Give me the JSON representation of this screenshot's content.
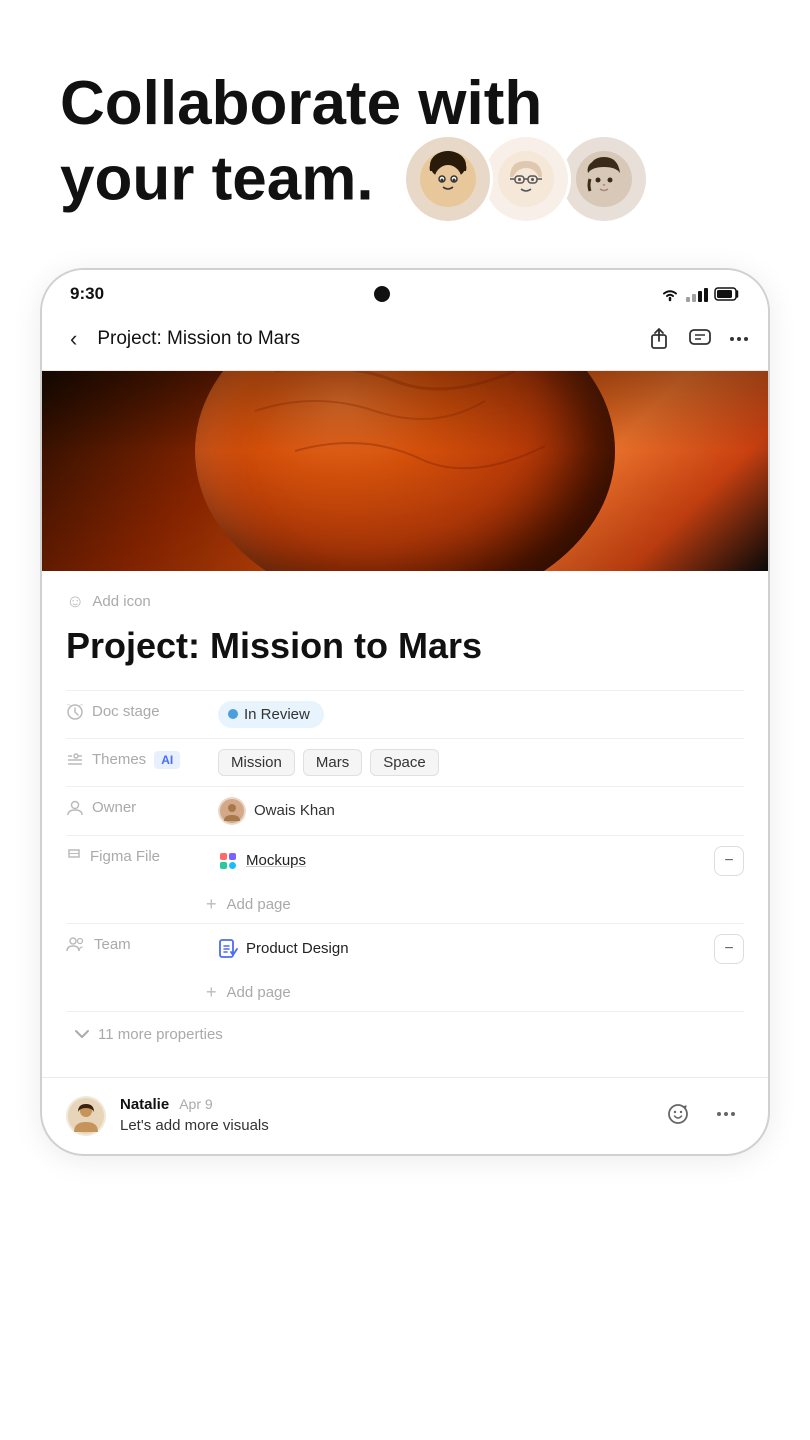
{
  "hero": {
    "title_line1": "Collaborate with",
    "title_line2": "your team.",
    "avatars": [
      "😮",
      "🧐",
      "😏"
    ]
  },
  "status_bar": {
    "time": "9:30",
    "signal_label": "signal"
  },
  "nav": {
    "back_icon": "‹",
    "title": "Project: Mission to Mars",
    "share_icon": "⬆",
    "comment_icon": "💬",
    "more_icon": "•••"
  },
  "content": {
    "add_icon_label": "Add icon",
    "project_title": "Project: Mission to Mars",
    "properties": {
      "doc_stage": {
        "label": "Doc stage",
        "value": "In Review"
      },
      "themes": {
        "label": "Themes",
        "ai_badge": "AI",
        "tags": [
          "Mission",
          "Mars",
          "Space"
        ]
      },
      "owner": {
        "label": "Owner",
        "name": "Owais Khan"
      },
      "figma_file": {
        "label": "Figma File",
        "value": "Mockups"
      },
      "team": {
        "label": "Team",
        "value": "Product Design"
      }
    },
    "add_page_label": "Add page",
    "more_properties": "11 more properties"
  },
  "comment": {
    "author": "Natalie",
    "date": "Apr 9",
    "text": "Let's add more visuals"
  }
}
